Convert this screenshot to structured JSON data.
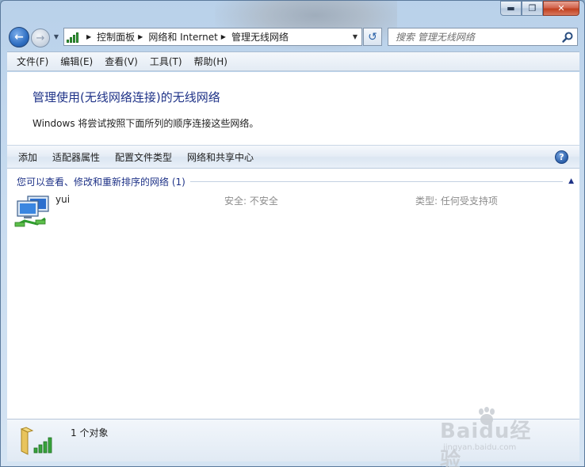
{
  "window": {
    "caption": {
      "minimize": "▬",
      "maximize": "❐",
      "close": "✕"
    }
  },
  "nav": {
    "breadcrumbs": [
      "控制面板",
      "网络和 Internet",
      "管理无线网络"
    ],
    "search_placeholder": "搜索 管理无线网络"
  },
  "menu": [
    "文件(F)",
    "编辑(E)",
    "查看(V)",
    "工具(T)",
    "帮助(H)"
  ],
  "page": {
    "heading": "管理使用(无线网络连接)的无线网络",
    "description": "Windows 将尝试按照下面所列的顺序连接这些网络。"
  },
  "commands": [
    "添加",
    "适配器属性",
    "配置文件类型",
    "网络和共享中心"
  ],
  "group": {
    "title": "您可以查看、修改和重新排序的网络 (1)"
  },
  "networks": [
    {
      "name": "yui",
      "security": "安全: 不安全",
      "type": "类型: 任何受支持项"
    }
  ],
  "status": {
    "count": "1 个对象"
  },
  "watermark": {
    "brand": "Baidu经验",
    "url": "jingyan.baidu.com"
  },
  "colors": {
    "link": "#1e3287",
    "accent": "#2f6fc2",
    "signal": "#37a33b"
  }
}
